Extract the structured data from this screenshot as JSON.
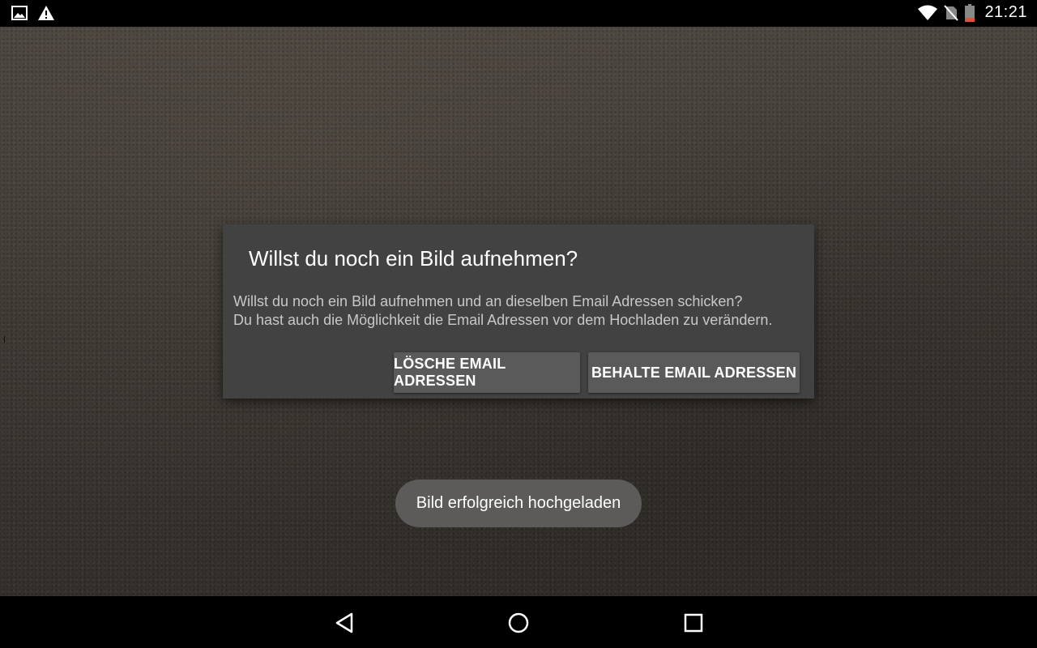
{
  "status_bar": {
    "time": "21:21",
    "left_icons": [
      "image-icon",
      "warning-icon"
    ],
    "right_icons": [
      "wifi-icon",
      "no-sim-icon",
      "battery-low-icon"
    ]
  },
  "dialog": {
    "title": "Willst du noch ein Bild aufnehmen?",
    "message_line1": "Willst du noch ein Bild aufnehmen und an dieselben Email Adressen schicken?",
    "message_line2": "Du hast auch die Möglichkeit die Email Adressen vor dem Hochladen zu verändern.",
    "button_delete": "LÖSCHE EMAIL ADRESSEN",
    "button_keep": "BEHALTE EMAIL ADRESSEN"
  },
  "toast": {
    "text": "Bild erfolgreich hochgeladen"
  },
  "nav_bar": {
    "buttons": [
      "back-icon",
      "home-icon",
      "recents-icon"
    ]
  },
  "colors": {
    "dialog_bg": "#424242",
    "button_bg": "#5a5a5a",
    "toast_bg": "#5c5b59",
    "battery_low": "#e0533a"
  }
}
